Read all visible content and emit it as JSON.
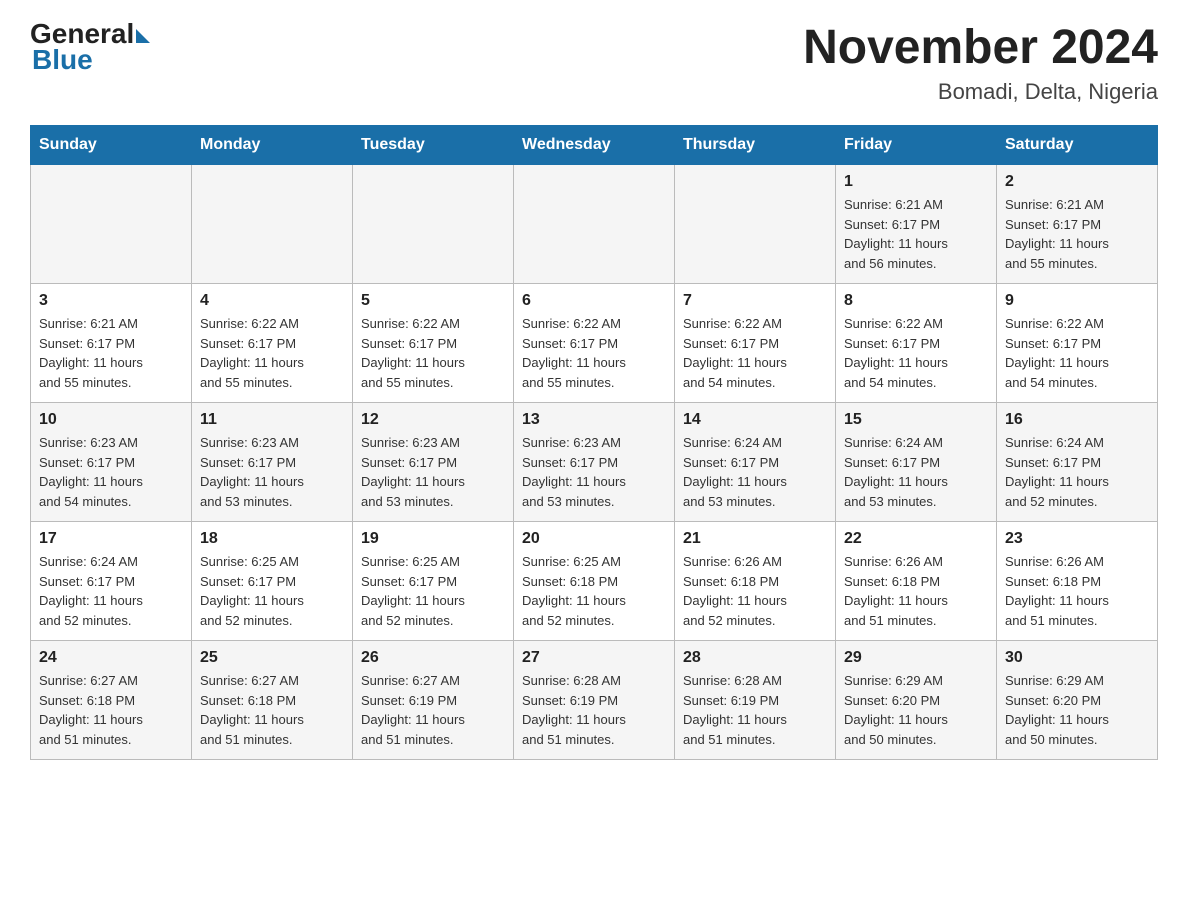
{
  "header": {
    "logo_general": "General",
    "logo_blue": "Blue",
    "title": "November 2024",
    "subtitle": "Bomadi, Delta, Nigeria"
  },
  "days_of_week": [
    "Sunday",
    "Monday",
    "Tuesday",
    "Wednesday",
    "Thursday",
    "Friday",
    "Saturday"
  ],
  "weeks": [
    [
      {
        "day": "",
        "info": ""
      },
      {
        "day": "",
        "info": ""
      },
      {
        "day": "",
        "info": ""
      },
      {
        "day": "",
        "info": ""
      },
      {
        "day": "",
        "info": ""
      },
      {
        "day": "1",
        "info": "Sunrise: 6:21 AM\nSunset: 6:17 PM\nDaylight: 11 hours\nand 56 minutes."
      },
      {
        "day": "2",
        "info": "Sunrise: 6:21 AM\nSunset: 6:17 PM\nDaylight: 11 hours\nand 55 minutes."
      }
    ],
    [
      {
        "day": "3",
        "info": "Sunrise: 6:21 AM\nSunset: 6:17 PM\nDaylight: 11 hours\nand 55 minutes."
      },
      {
        "day": "4",
        "info": "Sunrise: 6:22 AM\nSunset: 6:17 PM\nDaylight: 11 hours\nand 55 minutes."
      },
      {
        "day": "5",
        "info": "Sunrise: 6:22 AM\nSunset: 6:17 PM\nDaylight: 11 hours\nand 55 minutes."
      },
      {
        "day": "6",
        "info": "Sunrise: 6:22 AM\nSunset: 6:17 PM\nDaylight: 11 hours\nand 55 minutes."
      },
      {
        "day": "7",
        "info": "Sunrise: 6:22 AM\nSunset: 6:17 PM\nDaylight: 11 hours\nand 54 minutes."
      },
      {
        "day": "8",
        "info": "Sunrise: 6:22 AM\nSunset: 6:17 PM\nDaylight: 11 hours\nand 54 minutes."
      },
      {
        "day": "9",
        "info": "Sunrise: 6:22 AM\nSunset: 6:17 PM\nDaylight: 11 hours\nand 54 minutes."
      }
    ],
    [
      {
        "day": "10",
        "info": "Sunrise: 6:23 AM\nSunset: 6:17 PM\nDaylight: 11 hours\nand 54 minutes."
      },
      {
        "day": "11",
        "info": "Sunrise: 6:23 AM\nSunset: 6:17 PM\nDaylight: 11 hours\nand 53 minutes."
      },
      {
        "day": "12",
        "info": "Sunrise: 6:23 AM\nSunset: 6:17 PM\nDaylight: 11 hours\nand 53 minutes."
      },
      {
        "day": "13",
        "info": "Sunrise: 6:23 AM\nSunset: 6:17 PM\nDaylight: 11 hours\nand 53 minutes."
      },
      {
        "day": "14",
        "info": "Sunrise: 6:24 AM\nSunset: 6:17 PM\nDaylight: 11 hours\nand 53 minutes."
      },
      {
        "day": "15",
        "info": "Sunrise: 6:24 AM\nSunset: 6:17 PM\nDaylight: 11 hours\nand 53 minutes."
      },
      {
        "day": "16",
        "info": "Sunrise: 6:24 AM\nSunset: 6:17 PM\nDaylight: 11 hours\nand 52 minutes."
      }
    ],
    [
      {
        "day": "17",
        "info": "Sunrise: 6:24 AM\nSunset: 6:17 PM\nDaylight: 11 hours\nand 52 minutes."
      },
      {
        "day": "18",
        "info": "Sunrise: 6:25 AM\nSunset: 6:17 PM\nDaylight: 11 hours\nand 52 minutes."
      },
      {
        "day": "19",
        "info": "Sunrise: 6:25 AM\nSunset: 6:17 PM\nDaylight: 11 hours\nand 52 minutes."
      },
      {
        "day": "20",
        "info": "Sunrise: 6:25 AM\nSunset: 6:18 PM\nDaylight: 11 hours\nand 52 minutes."
      },
      {
        "day": "21",
        "info": "Sunrise: 6:26 AM\nSunset: 6:18 PM\nDaylight: 11 hours\nand 52 minutes."
      },
      {
        "day": "22",
        "info": "Sunrise: 6:26 AM\nSunset: 6:18 PM\nDaylight: 11 hours\nand 51 minutes."
      },
      {
        "day": "23",
        "info": "Sunrise: 6:26 AM\nSunset: 6:18 PM\nDaylight: 11 hours\nand 51 minutes."
      }
    ],
    [
      {
        "day": "24",
        "info": "Sunrise: 6:27 AM\nSunset: 6:18 PM\nDaylight: 11 hours\nand 51 minutes."
      },
      {
        "day": "25",
        "info": "Sunrise: 6:27 AM\nSunset: 6:18 PM\nDaylight: 11 hours\nand 51 minutes."
      },
      {
        "day": "26",
        "info": "Sunrise: 6:27 AM\nSunset: 6:19 PM\nDaylight: 11 hours\nand 51 minutes."
      },
      {
        "day": "27",
        "info": "Sunrise: 6:28 AM\nSunset: 6:19 PM\nDaylight: 11 hours\nand 51 minutes."
      },
      {
        "day": "28",
        "info": "Sunrise: 6:28 AM\nSunset: 6:19 PM\nDaylight: 11 hours\nand 51 minutes."
      },
      {
        "day": "29",
        "info": "Sunrise: 6:29 AM\nSunset: 6:20 PM\nDaylight: 11 hours\nand 50 minutes."
      },
      {
        "day": "30",
        "info": "Sunrise: 6:29 AM\nSunset: 6:20 PM\nDaylight: 11 hours\nand 50 minutes."
      }
    ]
  ]
}
